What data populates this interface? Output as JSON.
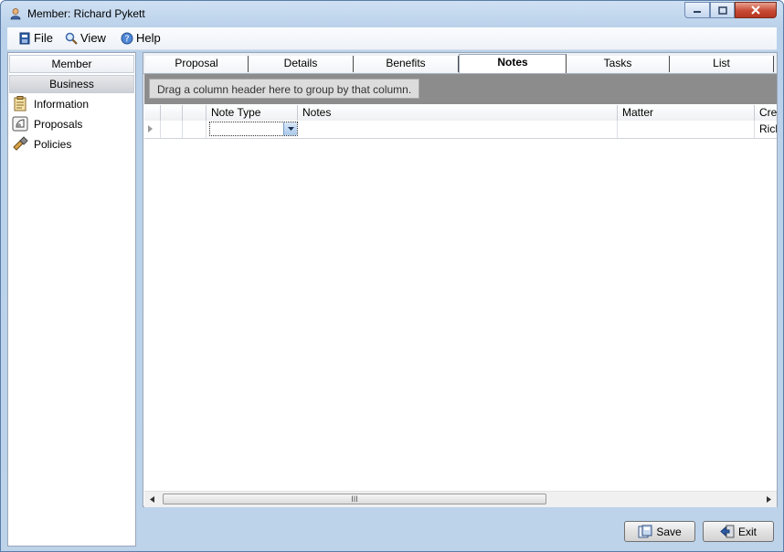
{
  "window": {
    "title": "Member: Richard Pykett",
    "controls": {
      "minimize": "minimize",
      "maximize": "maximize",
      "close": "close"
    }
  },
  "menu": {
    "items": [
      {
        "label": "File",
        "icon": "file-icon"
      },
      {
        "label": "View",
        "icon": "view-icon"
      },
      {
        "label": "Help",
        "icon": "help-icon"
      }
    ]
  },
  "sidebar": {
    "headers": [
      "Member",
      "Business"
    ],
    "items": [
      {
        "label": "Information",
        "icon": "information-icon"
      },
      {
        "label": "Proposals",
        "icon": "proposals-icon"
      },
      {
        "label": "Policies",
        "icon": "policies-icon"
      }
    ]
  },
  "tabs": {
    "items": [
      "Proposal",
      "Details",
      "Benefits",
      "Notes",
      "Tasks",
      "List"
    ],
    "active": "Notes"
  },
  "grid": {
    "group_hint": "Drag a column header here to group by that column.",
    "columns": [
      "",
      "",
      "",
      "Note Type",
      "Notes",
      "Matter",
      "Cre"
    ],
    "rows": [
      {
        "note_type": "",
        "notes": "",
        "matter": "",
        "created": "Rich"
      }
    ],
    "scroll_thumb": "III"
  },
  "buttons": {
    "save": "Save",
    "exit": "Exit"
  },
  "colors": {
    "frame": "#b9d1ea",
    "group_bar": "#8c8c8c",
    "close_button": "#c74a34"
  }
}
